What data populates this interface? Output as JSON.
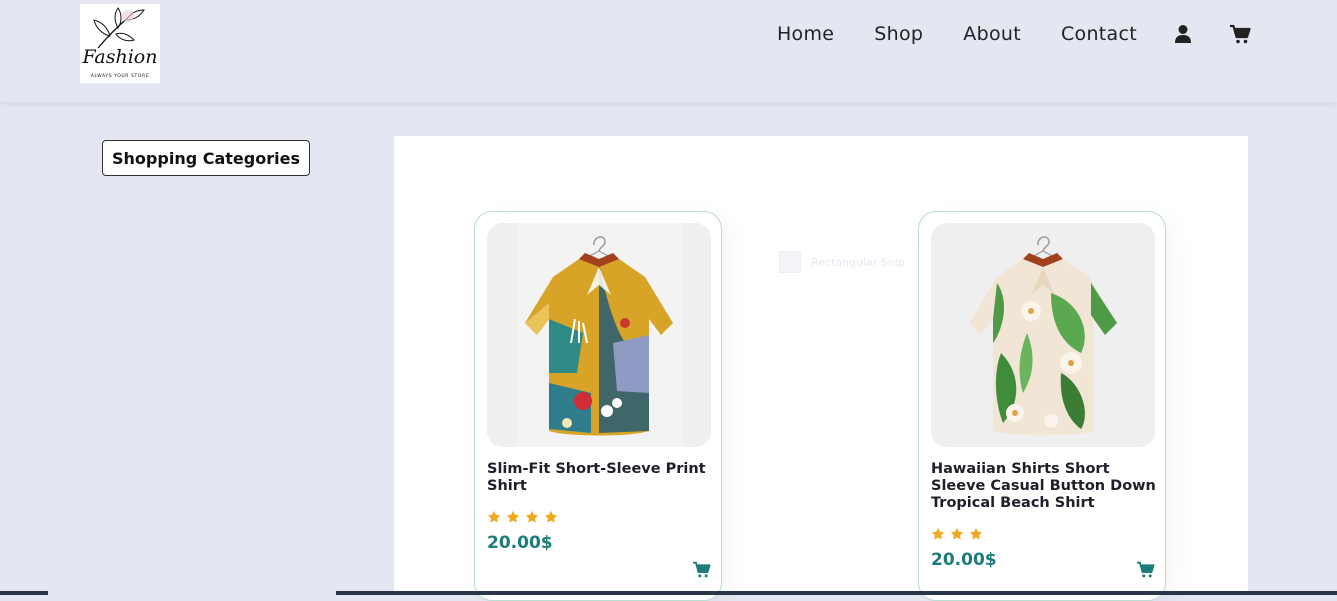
{
  "logo": {
    "word": "Fashion",
    "tagline": "ALWAYS YOUR STORE"
  },
  "nav": {
    "items": [
      {
        "label": "Home"
      },
      {
        "label": "Shop"
      },
      {
        "label": "About"
      },
      {
        "label": "Contact"
      }
    ],
    "icons": [
      "user-icon",
      "cart-icon"
    ]
  },
  "sidebar": {
    "categories_button": "Shopping Categories"
  },
  "overlay": {
    "ghost_label": "Rectangular Snip"
  },
  "products": [
    {
      "title": "Slim-Fit Short-Sleeve Print Shirt",
      "rating": 4,
      "price": "20.00$",
      "image": "shirt-print-image"
    },
    {
      "title": "Hawaiian Shirts Short Sleeve Casual Button Down Tropical Beach Shirt",
      "rating": 3,
      "price": "20.00$",
      "image": "shirt-floral-image"
    }
  ],
  "colors": {
    "accent": "#1c7c7a",
    "star": "#f0a81c",
    "background": "#e4e7f1"
  }
}
